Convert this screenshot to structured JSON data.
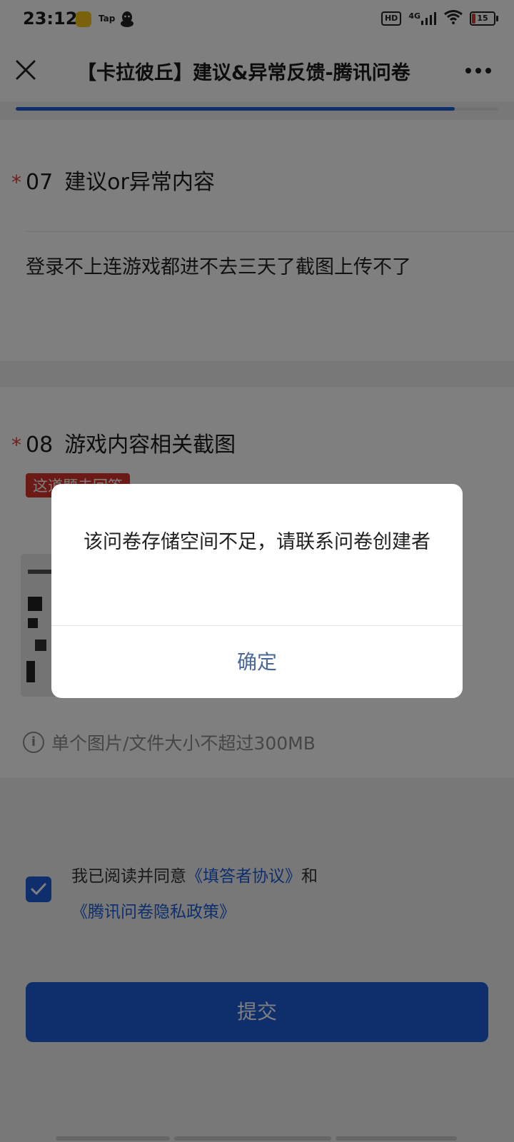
{
  "status_bar": {
    "time": "23:12",
    "tap_label": "Tap",
    "hd_label": "HD",
    "network": "4G",
    "battery": "15"
  },
  "app_bar": {
    "title": "【卡拉彼丘】建议&异常反馈-腾讯问卷",
    "progress": 0.91
  },
  "question_7": {
    "required_mark": "*",
    "number": "07",
    "title": "建议or异常内容",
    "answer": "登录不上连游戏都进不去三天了截图上传不了"
  },
  "question_8": {
    "required_mark": "*",
    "number": "08",
    "title": "游戏内容相关截图",
    "unanswered_tag": "这道题未回答",
    "hint": "单个图片/文件大小不超过300MB"
  },
  "agreement": {
    "checked": true,
    "prefix": "我已阅读并同意",
    "terms_link": "《填答者协议》",
    "conjunction": "和",
    "privacy_link": "《腾讯问卷隐私政策》"
  },
  "submit_label": "提交",
  "dialog": {
    "message": "该问卷存储空间不足，请联系问卷创建者",
    "confirm_label": "确定"
  },
  "icons": {
    "close": "close-icon",
    "more": "more-icon",
    "info": "info-icon",
    "check": "check-icon"
  },
  "colors": {
    "accent": "#1d5fd8",
    "required": "#e0403a",
    "dialog_button": "#4a6898"
  }
}
